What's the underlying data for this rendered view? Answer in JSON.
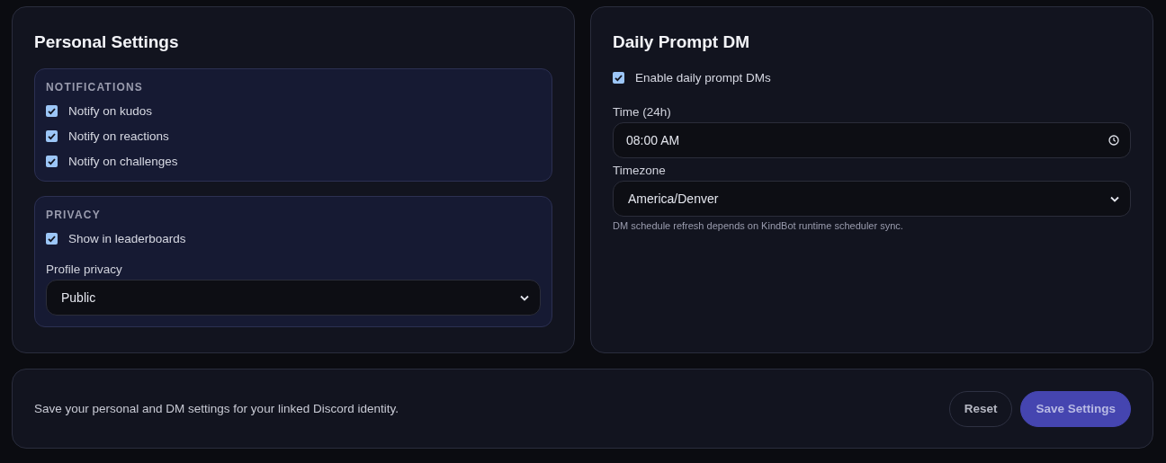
{
  "personal": {
    "title": "Personal Settings",
    "groups": [
      {
        "heading": "NOTIFICATIONS",
        "options": [
          {
            "label": "Notify on kudos",
            "checked": true
          },
          {
            "label": "Notify on reactions",
            "checked": true
          },
          {
            "label": "Notify on challenges",
            "checked": true
          }
        ]
      },
      {
        "heading": "PRIVACY",
        "options": [
          {
            "label": "Show in leaderboards",
            "checked": true
          }
        ],
        "select": {
          "label": "Profile privacy",
          "value": "Public"
        }
      }
    ]
  },
  "daily_prompt": {
    "title": "Daily Prompt DM",
    "enable": {
      "label": "Enable daily prompt DMs",
      "checked": true
    },
    "time": {
      "label": "Time (24h)",
      "value": "08:00 AM"
    },
    "timezone": {
      "label": "Timezone",
      "value": "America/Denver"
    },
    "hint": "DM schedule refresh depends on KindBot runtime scheduler sync."
  },
  "footer": {
    "text": "Save your personal and DM settings for your linked Discord identity.",
    "buttons": [
      {
        "label": "Reset",
        "kind": "secondary"
      },
      {
        "label": "Save Settings",
        "kind": "primary"
      }
    ]
  }
}
